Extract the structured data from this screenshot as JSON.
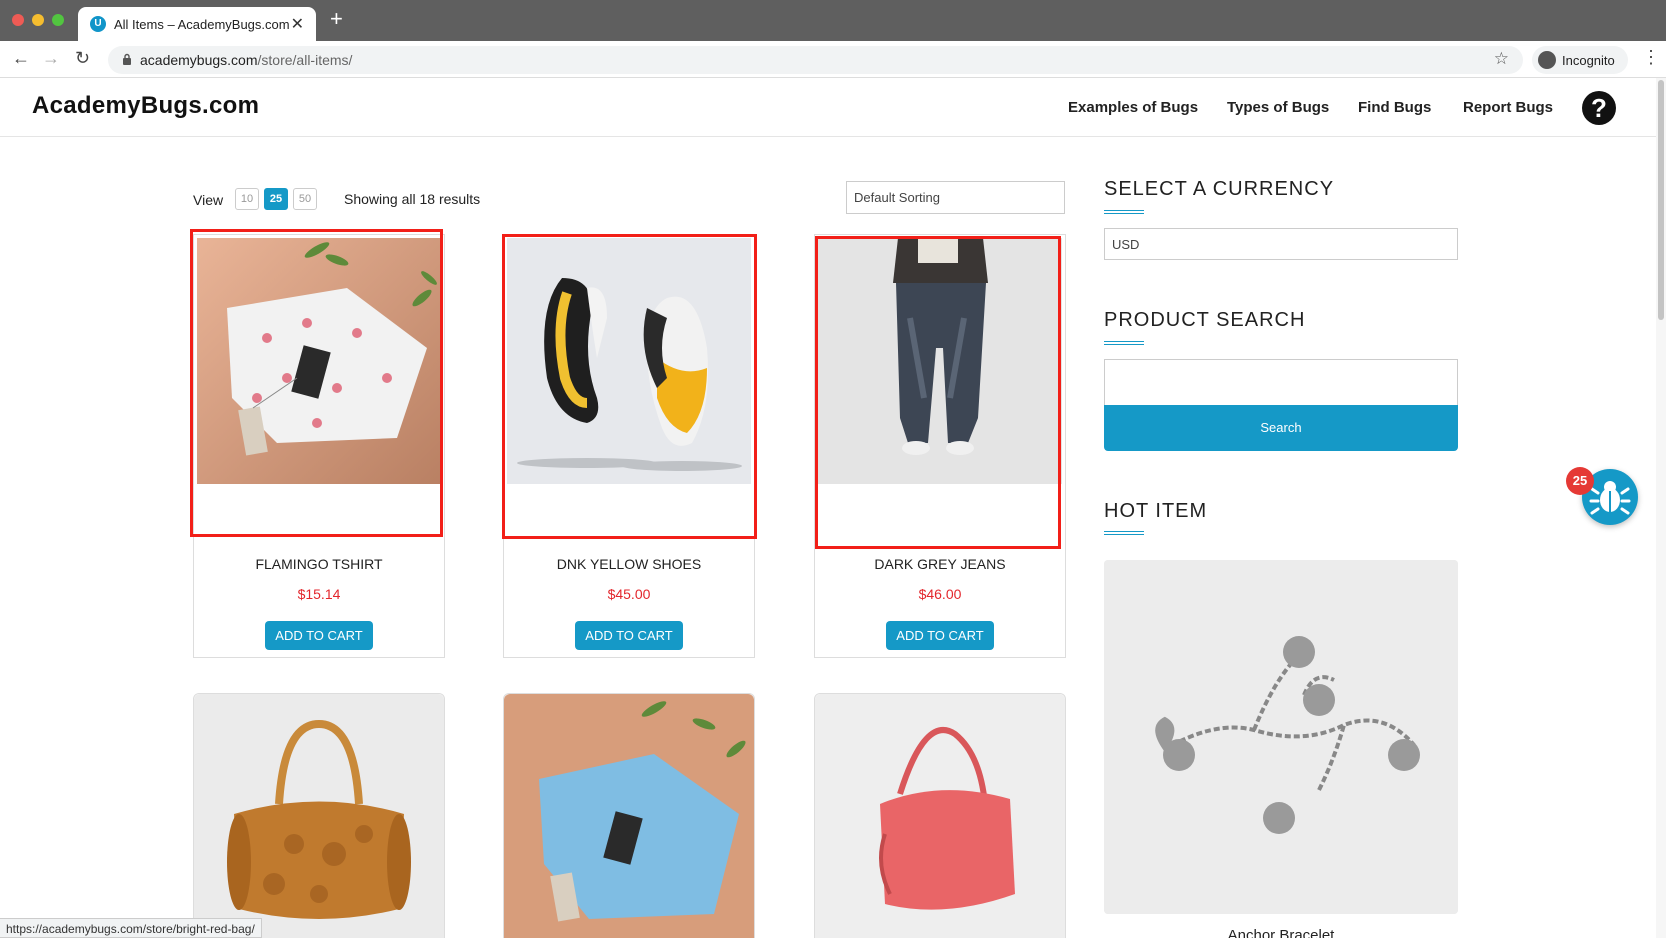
{
  "browser": {
    "tab_title": "All Items – AcademyBugs.com",
    "tab_favicon": "U",
    "url_host": "academybugs.com",
    "url_path": "/store/all-items/",
    "profile_label": "Incognito",
    "status_url": "https://academybugs.com/store/bright-red-bag/"
  },
  "site": {
    "logo": "AcademyBugs.com",
    "nav": [
      "Examples of Bugs",
      "Types of Bugs",
      "Find Bugs",
      "Report Bugs"
    ],
    "help_glyph": "?"
  },
  "shop": {
    "view_label": "View",
    "per_page": [
      "10",
      "25",
      "50"
    ],
    "per_page_selected": "25",
    "results_text": "Showing all 18 results",
    "sorting": "Default Sorting"
  },
  "products": [
    {
      "name": "FLAMINGO TSHIRT",
      "price": "$15.14",
      "button": "ADD TO CART",
      "highlighted": true
    },
    {
      "name": "DNK YELLOW SHOES",
      "price": "$45.00",
      "button": "ADD TO CART",
      "highlighted": true
    },
    {
      "name": "DARK GREY JEANS",
      "price": "$46.00",
      "button": "ADD TO CART",
      "highlighted": true
    }
  ],
  "sidebar": {
    "currency_title": "SELECT A CURRENCY",
    "currency_value": "USD",
    "search_title": "PRODUCT SEARCH",
    "search_button": "Search",
    "hot_title": "HOT ITEM",
    "hot_item_name": "Anchor Bracelet"
  },
  "bug_widget": {
    "count": "25"
  },
  "colors": {
    "accent": "#1599c7",
    "price": "#e3262c",
    "highlight": "#f21f18"
  }
}
